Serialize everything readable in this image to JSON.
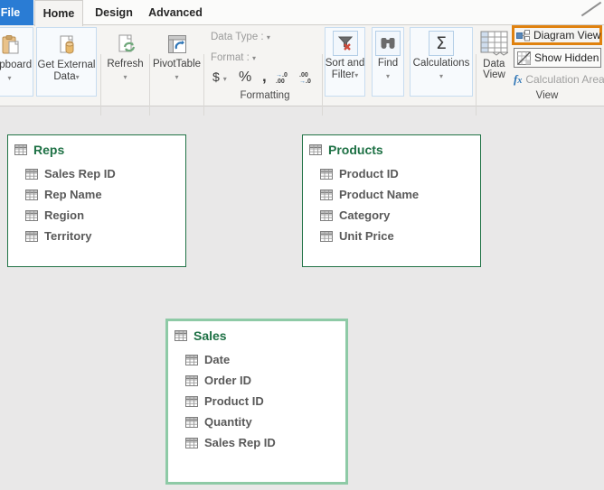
{
  "tabs": {
    "file": "File",
    "home": "Home",
    "design": "Design",
    "advanced": "Advanced"
  },
  "ribbon": {
    "clipboard": {
      "label": "Clipboard"
    },
    "get_external_data": {
      "line1": "Get External",
      "line2": "Data"
    },
    "refresh": {
      "label": "Refresh"
    },
    "pivottable": {
      "label": "PivotTable"
    },
    "formatting": {
      "data_type_label": "Data Type :",
      "format_label": "Format :",
      "currency": "$",
      "percent": "%",
      "comma": ",",
      "increase_decimal": {
        "line1": ".0",
        "line2": ".00"
      },
      "decrease_decimal": {
        "line1": ".00",
        "line2": ".0"
      },
      "group_label": "Formatting"
    },
    "sort_and_filter": {
      "line1": "Sort and",
      "line2": "Filter"
    },
    "find": {
      "label": "Find"
    },
    "calculations": {
      "label": "Calculations"
    },
    "view": {
      "data_view_line1": "Data",
      "data_view_line2": "View",
      "diagram_view": "Diagram View",
      "show_hidden": "Show Hidden",
      "calculation_area": "Calculation Area",
      "group_label": "View"
    }
  },
  "diagram": {
    "tables": [
      {
        "name": "Reps",
        "selected": false,
        "fields": [
          "Sales Rep ID",
          "Rep Name",
          "Region",
          "Territory"
        ]
      },
      {
        "name": "Products",
        "selected": false,
        "fields": [
          "Product ID",
          "Product Name",
          "Category",
          "Unit Price"
        ]
      },
      {
        "name": "Sales",
        "selected": true,
        "fields": [
          "Date",
          "Order ID",
          "Product ID",
          "Quantity",
          "Sales Rep ID"
        ]
      }
    ]
  },
  "colors": {
    "accent_green": "#217346",
    "field_text": "#595959",
    "selected_table_border": "#8ecaa6",
    "highlight_orange": "#e0820f",
    "file_tab_blue": "#2a7cd4",
    "canvas_background": "#e9e8e8"
  }
}
